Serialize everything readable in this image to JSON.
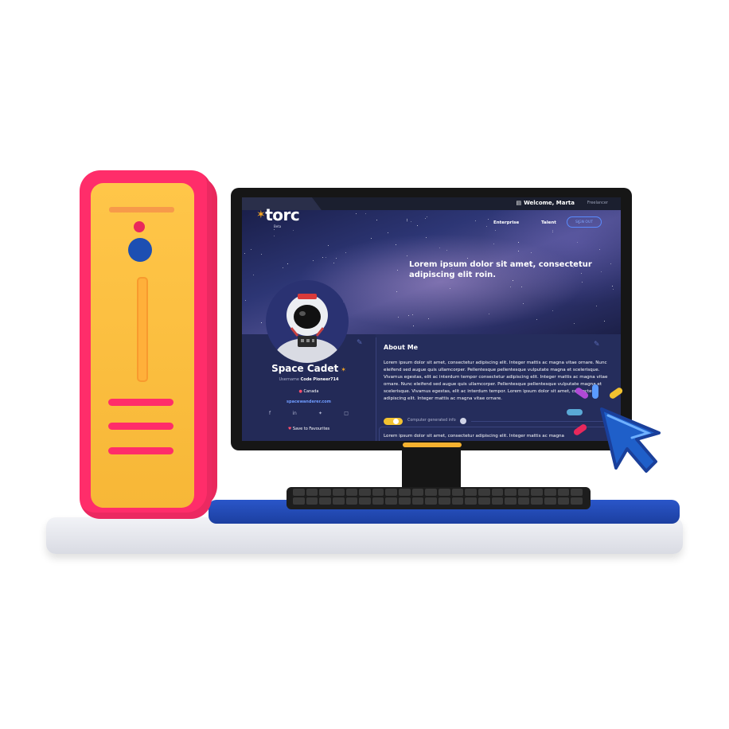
{
  "header": {
    "welcome": "Welcome, Marta",
    "role": "Freelancer"
  },
  "nav": {
    "logo": "torc",
    "beta": "Beta",
    "items": [
      "Enterprise",
      "Talent"
    ],
    "signout": "SIGN OUT"
  },
  "hero": {
    "tagline": "Lorem ipsum dolor sit amet, consectetur adipiscing elit roin."
  },
  "profile": {
    "name": "Space Cadet",
    "username_label": "Username",
    "username": "Code Pioneer714",
    "location": "Canada",
    "website": "spacewanderer.com",
    "favourites": "Save to Favourites",
    "social_icons": [
      "facebook-icon",
      "linkedin-icon",
      "twitter-icon",
      "instagram-icon"
    ]
  },
  "about": {
    "title": "About Me",
    "text": "Lorem ipsum dolor sit amet, consectetur adipiscing elit. Integer mattis ac magna vitae ornare. Nunc eleifend sed augue quis ullamcorper. Pellentesque pellentesque vulputate magna et scelerisque. Vivamus egestas, elit ac interdum tempor consectetur adipiscing elit. Integer mattis ac magna vitae ornare. Nunc eleifend sed augue quis ullamcorper. Pellentesque pellentesque vulputate magna et scelerisque. Vivamus egestas, elit ac interdum tempor. Lorem ipsum dolor sit amet, consectetur adipiscing elit. Integer mattis ac magna vitae ornare.",
    "generated_label": "Computer generated info",
    "generated_text": "Lorem ipsum dolor sit amet, consectetur adipiscing elit. Integer mattis ac magna"
  },
  "colors": {
    "tower": "#ff2d6a",
    "tower_face": "#ffc649",
    "desk_blue": "#1c3fa0",
    "screen_bg": "#232a57",
    "cursor": "#2f7be6"
  }
}
